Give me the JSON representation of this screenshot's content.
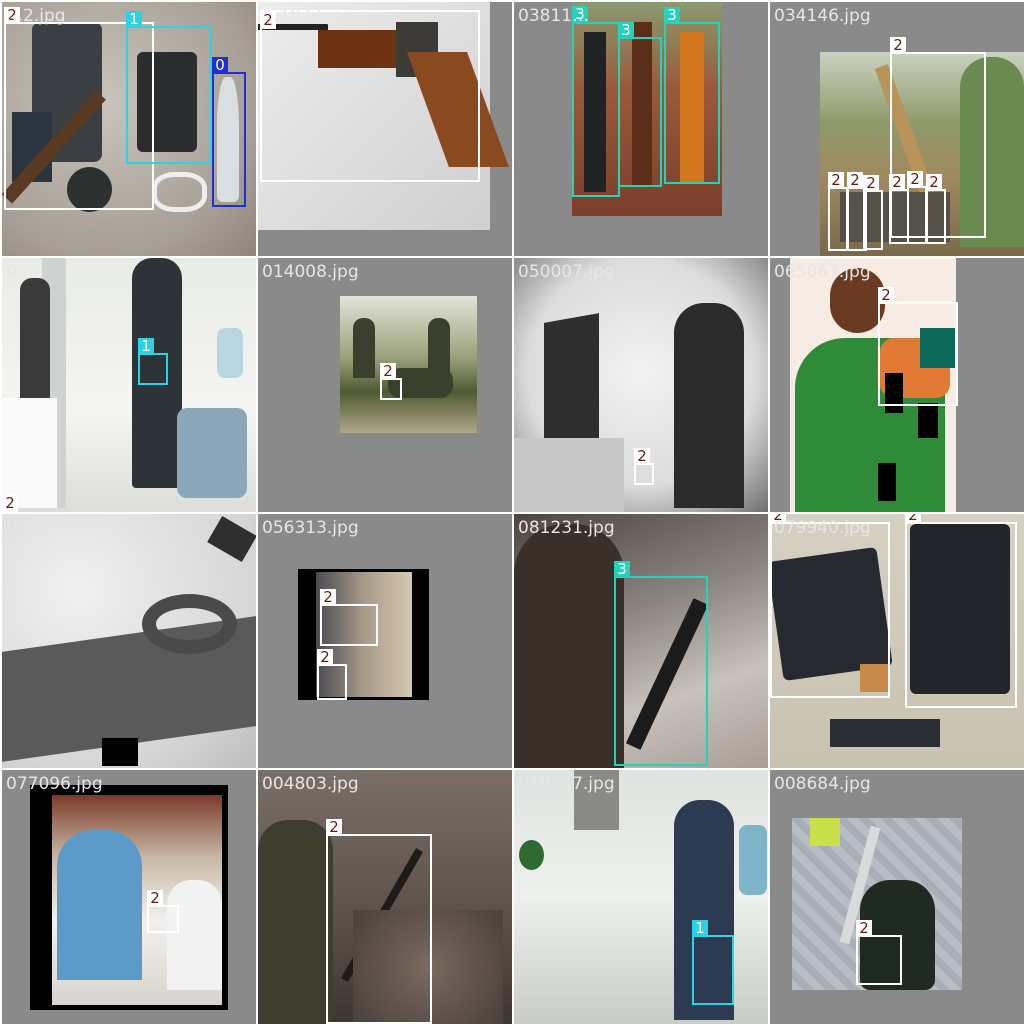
{
  "class_colors": {
    "0": {
      "stroke": "#1e2fd6",
      "tag_bg": "#1e2fd6",
      "tag_fg": "#ffffff"
    },
    "1": {
      "stroke": "#2ad4e6",
      "tag_bg": "#2ad4e6",
      "tag_fg": "#ffffff"
    },
    "2": {
      "stroke": "#ffffff",
      "tag_bg": "#ffffff",
      "tag_fg": "#6b1a12"
    },
    "3": {
      "stroke": "#25d1b8",
      "tag_bg": "#25d1b8",
      "tag_fg": "#ffffff"
    }
  },
  "tiles": [
    {
      "name": "…2.jpg",
      "scene": "weapons on rock floor",
      "boxes": [
        {
          "cls": "2"
        },
        {
          "cls": "1"
        },
        {
          "cls": "0"
        }
      ]
    },
    {
      "name": "…1077.jpg",
      "scene": "rifle stock closeup",
      "boxes": [
        {
          "cls": "2"
        }
      ]
    },
    {
      "name": "03811…",
      "scene": "three rifles on ground",
      "boxes": [
        {
          "cls": "3"
        },
        {
          "cls": "3"
        },
        {
          "cls": "3"
        }
      ]
    },
    {
      "name": "034146.jpg",
      "scene": "man at shooting range",
      "boxes": [
        {
          "cls": "2"
        },
        {
          "cls": "2"
        },
        {
          "cls": "2"
        },
        {
          "cls": "2"
        },
        {
          "cls": "2"
        },
        {
          "cls": "2"
        },
        {
          "cls": "2"
        }
      ]
    },
    {
      "name": "0…",
      "scene": "office hallway cctv",
      "boxes": [
        {
          "cls": "1"
        },
        {
          "cls": "2"
        }
      ]
    },
    {
      "name": "014008.jpg",
      "scene": "soldiers in grass",
      "boxes": [
        {
          "cls": "2"
        }
      ]
    },
    {
      "name": "050007.jpg",
      "scene": "man near monitor grayscale",
      "boxes": [
        {
          "cls": "2"
        }
      ]
    },
    {
      "name": "065067.jpg",
      "scene": "man in green holding pistol",
      "boxes": [
        {
          "cls": "2"
        }
      ]
    },
    {
      "name": "024…",
      "scene": "noisy pistol closeup",
      "boxes": []
    },
    {
      "name": "056313.jpg",
      "scene": "rotated group photo",
      "boxes": [
        {
          "cls": "2"
        },
        {
          "cls": "2"
        }
      ]
    },
    {
      "name": "081231.jpg",
      "scene": "rifle on sand",
      "boxes": [
        {
          "cls": "3"
        }
      ]
    },
    {
      "name": "079940.jpg",
      "scene": "two pistols and magazine",
      "boxes": [
        {
          "cls": "2"
        },
        {
          "cls": "2"
        }
      ]
    },
    {
      "name": "077096.jpg",
      "scene": "store counter cctv",
      "boxes": [
        {
          "cls": "2"
        }
      ]
    },
    {
      "name": "004803.jpg",
      "scene": "hunter with shotgun",
      "boxes": [
        {
          "cls": "2"
        }
      ]
    },
    {
      "name": "010647.jpg",
      "scene": "man in hallway with masked face",
      "boxes": [
        {
          "cls": "1"
        }
      ]
    },
    {
      "name": "008684.jpg",
      "scene": "man crouching overhead",
      "boxes": [
        {
          "cls": "2"
        }
      ]
    }
  ]
}
